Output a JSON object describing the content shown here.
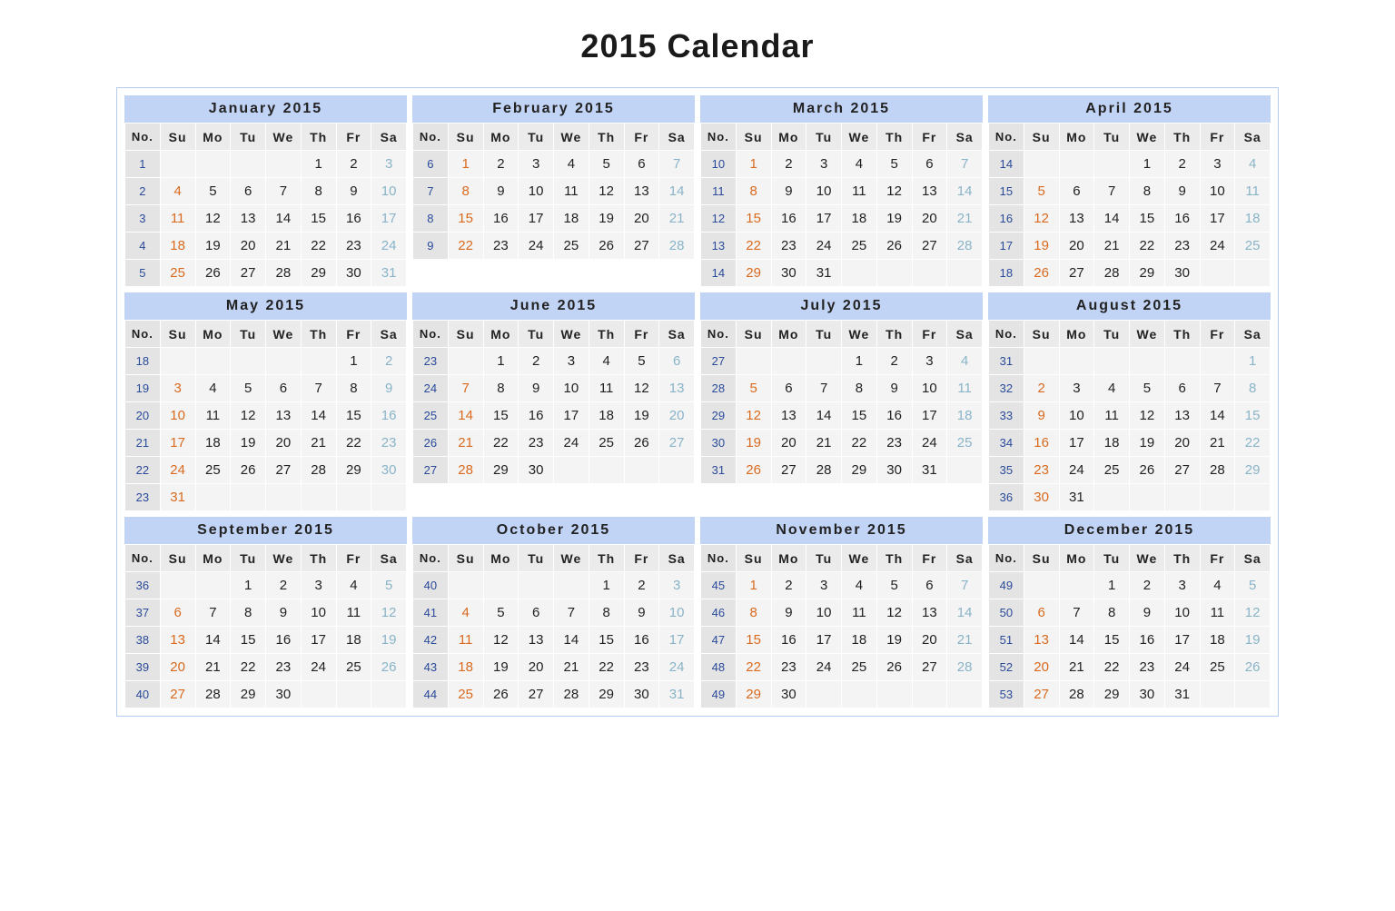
{
  "title": "2015 Calendar",
  "dayHeaders": [
    "No.",
    "Su",
    "Mo",
    "Tu",
    "We",
    "Th",
    "Fr",
    "Sa"
  ],
  "months": [
    {
      "name": "January 2015",
      "weeks": [
        {
          "no": 1,
          "d": [
            "",
            "",
            "",
            "",
            1,
            2,
            3
          ]
        },
        {
          "no": 2,
          "d": [
            4,
            5,
            6,
            7,
            8,
            9,
            10
          ]
        },
        {
          "no": 3,
          "d": [
            11,
            12,
            13,
            14,
            15,
            16,
            17
          ]
        },
        {
          "no": 4,
          "d": [
            18,
            19,
            20,
            21,
            22,
            23,
            24
          ]
        },
        {
          "no": 5,
          "d": [
            25,
            26,
            27,
            28,
            29,
            30,
            31
          ]
        }
      ]
    },
    {
      "name": "February 2015",
      "weeks": [
        {
          "no": 6,
          "d": [
            1,
            2,
            3,
            4,
            5,
            6,
            7
          ]
        },
        {
          "no": 7,
          "d": [
            8,
            9,
            10,
            11,
            12,
            13,
            14
          ]
        },
        {
          "no": 8,
          "d": [
            15,
            16,
            17,
            18,
            19,
            20,
            21
          ]
        },
        {
          "no": 9,
          "d": [
            22,
            23,
            24,
            25,
            26,
            27,
            28
          ]
        }
      ]
    },
    {
      "name": "March 2015",
      "weeks": [
        {
          "no": 10,
          "d": [
            1,
            2,
            3,
            4,
            5,
            6,
            7
          ]
        },
        {
          "no": 11,
          "d": [
            8,
            9,
            10,
            11,
            12,
            13,
            14
          ]
        },
        {
          "no": 12,
          "d": [
            15,
            16,
            17,
            18,
            19,
            20,
            21
          ]
        },
        {
          "no": 13,
          "d": [
            22,
            23,
            24,
            25,
            26,
            27,
            28
          ]
        },
        {
          "no": 14,
          "d": [
            29,
            30,
            31,
            "",
            "",
            "",
            ""
          ]
        }
      ]
    },
    {
      "name": "April 2015",
      "weeks": [
        {
          "no": 14,
          "d": [
            "",
            "",
            "",
            1,
            2,
            3,
            4
          ]
        },
        {
          "no": 15,
          "d": [
            5,
            6,
            7,
            8,
            9,
            10,
            11
          ]
        },
        {
          "no": 16,
          "d": [
            12,
            13,
            14,
            15,
            16,
            17,
            18
          ]
        },
        {
          "no": 17,
          "d": [
            19,
            20,
            21,
            22,
            23,
            24,
            25
          ]
        },
        {
          "no": 18,
          "d": [
            26,
            27,
            28,
            29,
            30,
            "",
            ""
          ]
        }
      ]
    },
    {
      "name": "May 2015",
      "weeks": [
        {
          "no": 18,
          "d": [
            "",
            "",
            "",
            "",
            "",
            1,
            2
          ]
        },
        {
          "no": 19,
          "d": [
            3,
            4,
            5,
            6,
            7,
            8,
            9
          ]
        },
        {
          "no": 20,
          "d": [
            10,
            11,
            12,
            13,
            14,
            15,
            16
          ]
        },
        {
          "no": 21,
          "d": [
            17,
            18,
            19,
            20,
            21,
            22,
            23
          ]
        },
        {
          "no": 22,
          "d": [
            24,
            25,
            26,
            27,
            28,
            29,
            30
          ]
        },
        {
          "no": 23,
          "d": [
            31,
            "",
            "",
            "",
            "",
            "",
            ""
          ]
        }
      ]
    },
    {
      "name": "June 2015",
      "weeks": [
        {
          "no": 23,
          "d": [
            "",
            1,
            2,
            3,
            4,
            5,
            6
          ]
        },
        {
          "no": 24,
          "d": [
            7,
            8,
            9,
            10,
            11,
            12,
            13
          ]
        },
        {
          "no": 25,
          "d": [
            14,
            15,
            16,
            17,
            18,
            19,
            20
          ]
        },
        {
          "no": 26,
          "d": [
            21,
            22,
            23,
            24,
            25,
            26,
            27
          ]
        },
        {
          "no": 27,
          "d": [
            28,
            29,
            30,
            "",
            "",
            "",
            ""
          ]
        }
      ]
    },
    {
      "name": "July 2015",
      "weeks": [
        {
          "no": 27,
          "d": [
            "",
            "",
            "",
            1,
            2,
            3,
            4
          ]
        },
        {
          "no": 28,
          "d": [
            5,
            6,
            7,
            8,
            9,
            10,
            11
          ]
        },
        {
          "no": 29,
          "d": [
            12,
            13,
            14,
            15,
            16,
            17,
            18
          ]
        },
        {
          "no": 30,
          "d": [
            19,
            20,
            21,
            22,
            23,
            24,
            25
          ]
        },
        {
          "no": 31,
          "d": [
            26,
            27,
            28,
            29,
            30,
            31,
            ""
          ]
        }
      ]
    },
    {
      "name": "August 2015",
      "weeks": [
        {
          "no": 31,
          "d": [
            "",
            "",
            "",
            "",
            "",
            "",
            1
          ]
        },
        {
          "no": 32,
          "d": [
            2,
            3,
            4,
            5,
            6,
            7,
            8
          ]
        },
        {
          "no": 33,
          "d": [
            9,
            10,
            11,
            12,
            13,
            14,
            15
          ]
        },
        {
          "no": 34,
          "d": [
            16,
            17,
            18,
            19,
            20,
            21,
            22
          ]
        },
        {
          "no": 35,
          "d": [
            23,
            24,
            25,
            26,
            27,
            28,
            29
          ]
        },
        {
          "no": 36,
          "d": [
            30,
            31,
            "",
            "",
            "",
            "",
            ""
          ]
        }
      ]
    },
    {
      "name": "September 2015",
      "weeks": [
        {
          "no": 36,
          "d": [
            "",
            "",
            1,
            2,
            3,
            4,
            5
          ]
        },
        {
          "no": 37,
          "d": [
            6,
            7,
            8,
            9,
            10,
            11,
            12
          ]
        },
        {
          "no": 38,
          "d": [
            13,
            14,
            15,
            16,
            17,
            18,
            19
          ]
        },
        {
          "no": 39,
          "d": [
            20,
            21,
            22,
            23,
            24,
            25,
            26
          ]
        },
        {
          "no": 40,
          "d": [
            27,
            28,
            29,
            30,
            "",
            "",
            ""
          ]
        }
      ]
    },
    {
      "name": "October 2015",
      "weeks": [
        {
          "no": 40,
          "d": [
            "",
            "",
            "",
            "",
            1,
            2,
            3
          ]
        },
        {
          "no": 41,
          "d": [
            4,
            5,
            6,
            7,
            8,
            9,
            10
          ]
        },
        {
          "no": 42,
          "d": [
            11,
            12,
            13,
            14,
            15,
            16,
            17
          ]
        },
        {
          "no": 43,
          "d": [
            18,
            19,
            20,
            21,
            22,
            23,
            24
          ]
        },
        {
          "no": 44,
          "d": [
            25,
            26,
            27,
            28,
            29,
            30,
            31
          ]
        }
      ]
    },
    {
      "name": "November 2015",
      "weeks": [
        {
          "no": 45,
          "d": [
            1,
            2,
            3,
            4,
            5,
            6,
            7
          ]
        },
        {
          "no": 46,
          "d": [
            8,
            9,
            10,
            11,
            12,
            13,
            14
          ]
        },
        {
          "no": 47,
          "d": [
            15,
            16,
            17,
            18,
            19,
            20,
            21
          ]
        },
        {
          "no": 48,
          "d": [
            22,
            23,
            24,
            25,
            26,
            27,
            28
          ]
        },
        {
          "no": 49,
          "d": [
            29,
            30,
            "",
            "",
            "",
            "",
            ""
          ]
        }
      ]
    },
    {
      "name": "December 2015",
      "weeks": [
        {
          "no": 49,
          "d": [
            "",
            "",
            1,
            2,
            3,
            4,
            5
          ]
        },
        {
          "no": 50,
          "d": [
            6,
            7,
            8,
            9,
            10,
            11,
            12
          ]
        },
        {
          "no": 51,
          "d": [
            13,
            14,
            15,
            16,
            17,
            18,
            19
          ]
        },
        {
          "no": 52,
          "d": [
            20,
            21,
            22,
            23,
            24,
            25,
            26
          ]
        },
        {
          "no": 53,
          "d": [
            27,
            28,
            29,
            30,
            31,
            "",
            ""
          ]
        }
      ]
    }
  ]
}
